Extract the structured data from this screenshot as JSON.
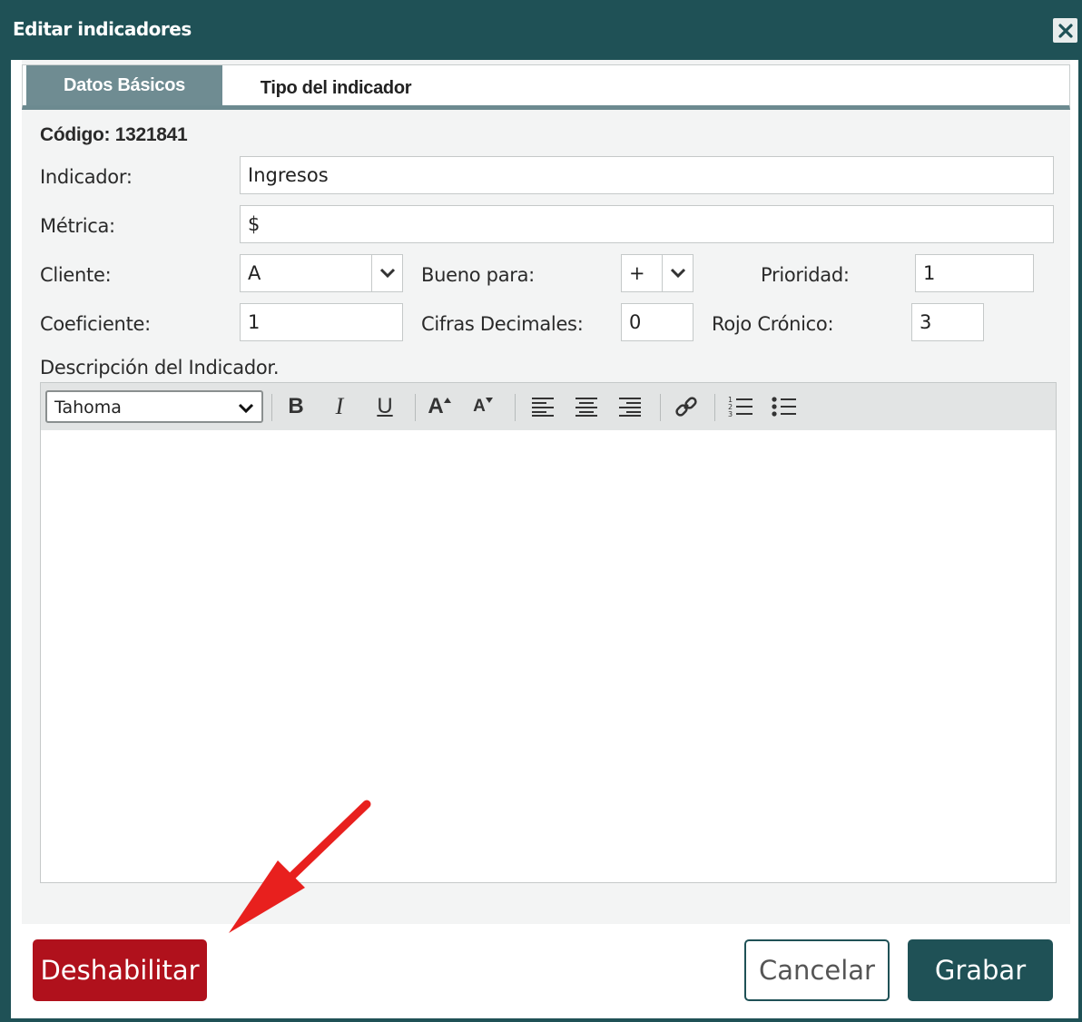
{
  "dialog": {
    "title": "Editar indicadores",
    "close_label": "✕"
  },
  "tabs": [
    {
      "label": "Datos Básicos",
      "active": true
    },
    {
      "label": "Tipo del indicador",
      "active": false
    }
  ],
  "form": {
    "codigo": "Código: 1321841",
    "indicador_label": "Indicador:",
    "indicador_value": "Ingresos",
    "metrica_label": "Métrica:",
    "metrica_value": "$",
    "cliente_label": "Cliente:",
    "cliente_value": "A",
    "bueno_label": "Bueno para:",
    "bueno_value": "+",
    "prioridad_label": "Prioridad:",
    "prioridad_value": "1",
    "coeficiente_label": "Coeficiente:",
    "coeficiente_value": "1",
    "cifras_label": "Cifras Decimales:",
    "cifras_value": "0",
    "rojo_label": "Rojo Crónico:",
    "rojo_value": "3",
    "descripcion_label": "Descripción del Indicador."
  },
  "editor": {
    "font_value": "Tahoma",
    "tools": [
      "bold-icon",
      "italic-icon",
      "underline-icon",
      "font-size-increase-icon",
      "font-size-decrease-icon",
      "align-left-icon",
      "align-center-icon",
      "align-right-icon",
      "link-icon",
      "ordered-list-icon",
      "unordered-list-icon"
    ],
    "bold_glyph": "B",
    "italic_glyph": "I",
    "underline_glyph": "U",
    "grow_glyph": "A",
    "shrink_glyph": "A"
  },
  "buttons": {
    "disable": "Deshabilitar",
    "cancel": "Cancelar",
    "save": "Grabar"
  },
  "colors": {
    "header": "#1f5156",
    "tab_active": "#6f8c92",
    "disable_button": "#b0111c",
    "annotation_arrow": "#e8201e"
  }
}
